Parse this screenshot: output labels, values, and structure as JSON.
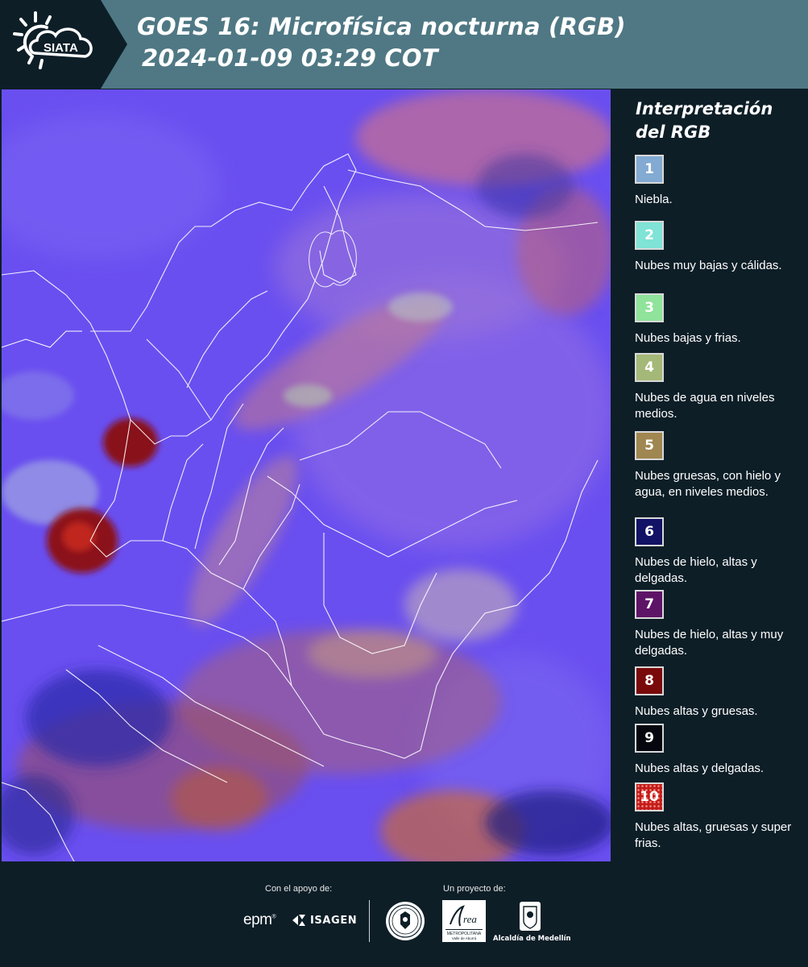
{
  "header": {
    "logo_text": "SIATA",
    "title_line1": "GOES 16: Microfísica nocturna (RGB)",
    "title_line2": "2024-01-09 03:29 COT"
  },
  "map": {
    "base_color": "#6a4ff0",
    "border_color": "#ffffff",
    "icon": "satellite-map"
  },
  "legend": {
    "title_line1": "Interpretación",
    "title_line2": "del RGB",
    "items": [
      {
        "number": "1",
        "color": "#82aad2",
        "label": "Niebla."
      },
      {
        "number": "2",
        "color": "#7fe3d6",
        "label": "Nubes muy bajas y cálidas."
      },
      {
        "number": "3",
        "color": "#8fe39a",
        "label": "Nubes bajas y frias."
      },
      {
        "number": "4",
        "color": "#a4b878",
        "label": "Nubes de agua en niveles medios."
      },
      {
        "number": "5",
        "color": "#a08650",
        "label": "Nubes gruesas, con hielo y agua, en niveles medios."
      },
      {
        "number": "6",
        "color": "#121266",
        "label": "Nubes de hielo, altas y delgadas."
      },
      {
        "number": "7",
        "color": "#5e1466",
        "label": "Nubes de hielo, altas y muy delgadas."
      },
      {
        "number": "8",
        "color": "#7a0a0a",
        "label": "Nubes altas y gruesas."
      },
      {
        "number": "9",
        "color": "#05060e",
        "label": "Nubes altas y delgadas."
      },
      {
        "number": "10",
        "color": "#c41c1c",
        "label": "Nubes altas, gruesas y super frias."
      }
    ]
  },
  "footer": {
    "support_caption": "Con el apoyo de:",
    "project_caption": "Un proyecto de:",
    "epm_logo": "epm",
    "isagen_logo": "ISAGEN",
    "metropolitana_logo": "Área Metropolitana Valle de Aburrá",
    "alcaldia_logo": "Alcaldía de Medellín"
  }
}
